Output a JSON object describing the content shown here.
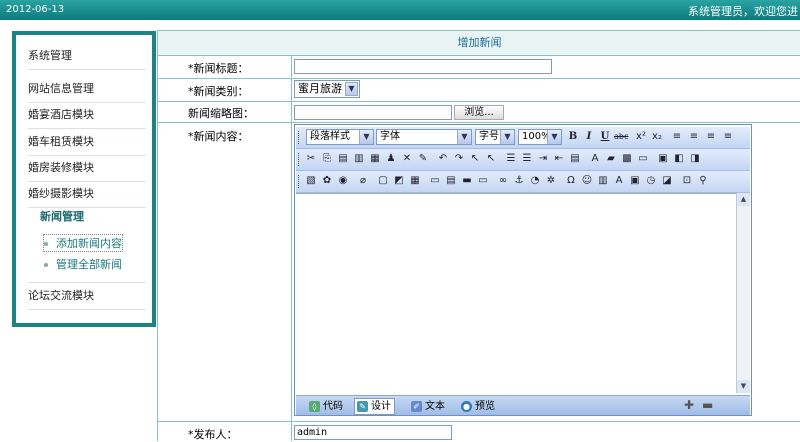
{
  "topbar": {
    "date": "2012-06-13",
    "welcome": "系统管理员，欢迎您进"
  },
  "sidebar": {
    "items": [
      {
        "label": "系统管理"
      },
      {
        "label": "网站信息管理"
      },
      {
        "label": "婚宴酒店模块"
      },
      {
        "label": "婚车租赁模块"
      },
      {
        "label": "婚房装修模块"
      },
      {
        "label": "婚纱摄影模块"
      }
    ],
    "news_title": "新闻管理",
    "news_sub": [
      "添加新闻内容",
      "管理全部新闻"
    ],
    "forum": "论坛交流模块"
  },
  "form": {
    "header": "增加新闻",
    "title_label": "*新闻标题：",
    "title_value": "",
    "category_label": "*新闻类别：",
    "category_value": "蜜月旅游",
    "thumb_label": "新闻缩略图：",
    "browse_label": "浏览...",
    "content_label": "*新闻内容：",
    "publisher_label": "*发布人：",
    "publisher_value": "admin"
  },
  "editor": {
    "paragraph_style": "段落样式",
    "font": "字体",
    "size": "字号",
    "zoom": "100%",
    "modes": [
      "代码",
      "设计",
      "文本",
      "预览"
    ],
    "active_mode": "设计"
  },
  "colors": {
    "accent": "#1c8486",
    "toolbar": "#c3d6f3",
    "border": "#89c4c4"
  }
}
